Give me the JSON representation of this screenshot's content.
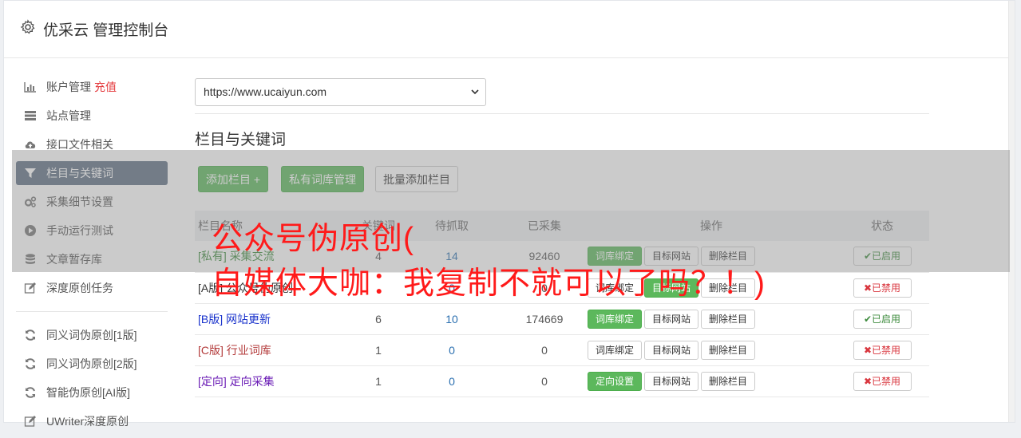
{
  "header": {
    "title": "优采云 管理控制台",
    "icon": "gear-icon"
  },
  "sidebar": {
    "items": [
      {
        "label": "账户管理",
        "extra": "充值",
        "icon": "bar-chart-icon",
        "active": false
      },
      {
        "label": "站点管理",
        "icon": "server-icon",
        "active": false
      },
      {
        "label": "接口文件相关",
        "icon": "cloud-upload-icon",
        "active": false
      },
      {
        "label": "栏目与关键词",
        "icon": "filter-icon",
        "active": true
      },
      {
        "label": "采集细节设置",
        "icon": "gears-icon",
        "active": false
      },
      {
        "label": "手动运行测试",
        "icon": "play-circle-icon",
        "active": false
      },
      {
        "label": "文章暂存库",
        "icon": "database-icon",
        "active": false
      },
      {
        "label": "深度原创任务",
        "icon": "edit-icon",
        "active": false
      }
    ],
    "items2": [
      {
        "label": "同义词伪原创[1版]",
        "icon": "refresh-icon"
      },
      {
        "label": "同义词伪原创[2版]",
        "icon": "refresh-icon"
      },
      {
        "label": "智能伪原创[AI版]",
        "icon": "refresh-icon"
      },
      {
        "label": "UWriter深度原创",
        "icon": "edit-icon"
      }
    ]
  },
  "main": {
    "site_select": {
      "value": "https://www.ucaiyun.com"
    },
    "section_title": "栏目与关键词",
    "buttons": {
      "add_column": "添加栏目 +",
      "private_lib": "私有词库管理",
      "batch_add": "批量添加栏目"
    },
    "table": {
      "headers": [
        "栏目名称",
        "关键词",
        "待抓取",
        "已采集",
        "操作",
        "状态"
      ],
      "rows": [
        {
          "name": "[私有] 采集交流",
          "style": "green",
          "keywords": "4",
          "pending": "14",
          "collected": "92460",
          "op1": "词库绑定",
          "op1_green": true,
          "op2": "目标网站",
          "op3": "删除栏目",
          "status": "✔已启用",
          "on": true
        },
        {
          "name": "[A版] 公众号伪原创",
          "style": "dark",
          "keywords": "",
          "pending": "0",
          "collected": "0",
          "op1": "词库绑定",
          "op1_green": false,
          "op2": "目标网站",
          "op2_green": true,
          "op3": "删除栏目",
          "status": "✖已禁用",
          "on": false
        },
        {
          "name": "[B版] 网站更新",
          "style": "blue",
          "keywords": "6",
          "pending": "10",
          "collected": "174669",
          "op1": "词库绑定",
          "op1_green": true,
          "op2": "目标网站",
          "op3": "删除栏目",
          "status": "✔已启用",
          "on": true
        },
        {
          "name": "[C版] 行业词库",
          "style": "red",
          "keywords": "1",
          "pending": "0",
          "collected": "0",
          "op1": "词库绑定",
          "op1_green": false,
          "op2": "目标网站",
          "op3": "删除栏目",
          "status": "✖已禁用",
          "on": false
        },
        {
          "name": "[定向] 定向采集",
          "style": "purple",
          "keywords": "1",
          "pending": "0",
          "collected": "0",
          "op1": "定向设置",
          "op1_green": true,
          "op2": "目标网站",
          "op3": "删除栏目",
          "status": "✖已禁用",
          "on": false
        }
      ]
    }
  },
  "watermark": {
    "line1": "公众号伪原创(",
    "line2": "自媒体大咖：我复制不就可以了吗？！)"
  },
  "colors": {
    "green": "#5cb85c",
    "active_nav": "#5f6f84",
    "watermark": "#ff1a1a"
  }
}
